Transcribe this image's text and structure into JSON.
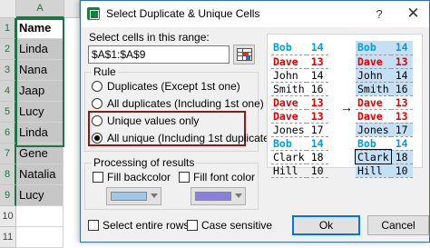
{
  "sheet": {
    "column": "A",
    "rows": [
      "1",
      "2",
      "3",
      "4",
      "5",
      "6",
      "7",
      "8",
      "9",
      "10",
      "11"
    ],
    "cells": [
      "Name",
      "Linda",
      "Nana",
      "Jaap",
      "Lucy",
      "Linda",
      "Gene",
      "Natalia",
      "Lucy",
      "",
      ""
    ]
  },
  "dialog": {
    "title": "Select Duplicate & Unique Cells",
    "help": "?",
    "close": "✕",
    "range_label": "Select cells in this range:",
    "range_value": "$A$1:$A$9",
    "rule": {
      "title": "Rule",
      "options": [
        {
          "label": "Duplicates (Except 1st one)",
          "selected": false
        },
        {
          "label": "All duplicates (Including 1st one)",
          "selected": false
        },
        {
          "label": "Unique values only",
          "selected": false
        },
        {
          "label": "All unique (Including 1st duplicates)",
          "selected": true
        }
      ]
    },
    "processing": {
      "title": "Processing of results",
      "fill_backcolor": "Fill backcolor",
      "fill_font_color": "Fill font color",
      "backcolor": "#9ec7e8",
      "font_color": "#8a7fe0"
    },
    "select_entire_rows": "Select entire rows",
    "case_sensitive": "Case sensitive",
    "ok": "Ok",
    "cancel": "Cancel"
  },
  "preview": {
    "arrow": "→",
    "before": [
      {
        "name": "Bob",
        "val": "14",
        "color": "#00a0d8",
        "bold": true,
        "bg": ""
      },
      {
        "name": "Dave",
        "val": "13",
        "color": "#e00000",
        "bold": true,
        "bg": ""
      },
      {
        "name": "John",
        "val": "14",
        "color": "#000000",
        "bold": false,
        "bg": ""
      },
      {
        "name": "Smith",
        "val": "16",
        "color": "#000000",
        "bold": false,
        "bg": ""
      },
      {
        "name": "Dave",
        "val": "13",
        "color": "#e00000",
        "bold": true,
        "bg": ""
      },
      {
        "name": "Dave",
        "val": "13",
        "color": "#e00000",
        "bold": true,
        "bg": ""
      },
      {
        "name": "Jones",
        "val": "17",
        "color": "#000000",
        "bold": false,
        "bg": ""
      },
      {
        "name": "Bob",
        "val": "14",
        "color": "#00a0d8",
        "bold": true,
        "bg": ""
      },
      {
        "name": "Clark",
        "val": "18",
        "color": "#000000",
        "bold": false,
        "bg": ""
      },
      {
        "name": "Hill",
        "val": "10",
        "color": "#000000",
        "bold": false,
        "bg": ""
      }
    ],
    "after": [
      {
        "name": "Bob",
        "val": "14",
        "color": "#00a0d8",
        "bold": true,
        "bg": "#c5dff5"
      },
      {
        "name": "Dave",
        "val": "13",
        "color": "#e00000",
        "bold": true,
        "bg": "#c5dff5"
      },
      {
        "name": "John",
        "val": "14",
        "color": "#000000",
        "bold": false,
        "bg": "#c5dff5"
      },
      {
        "name": "Smith",
        "val": "16",
        "color": "#000000",
        "bold": false,
        "bg": "#c5dff5"
      },
      {
        "name": "Dave",
        "val": "13",
        "color": "#e00000",
        "bold": true,
        "bg": ""
      },
      {
        "name": "Dave",
        "val": "13",
        "color": "#e00000",
        "bold": true,
        "bg": ""
      },
      {
        "name": "Jones",
        "val": "17",
        "color": "#000000",
        "bold": false,
        "bg": "#c5dff5"
      },
      {
        "name": "Bob",
        "val": "14",
        "color": "#00a0d8",
        "bold": true,
        "bg": ""
      },
      {
        "name": "Clark",
        "val": "18",
        "color": "#000000",
        "bold": false,
        "bg": "#c5dff5"
      },
      {
        "name": "Hill",
        "val": "10",
        "color": "#000000",
        "bold": false,
        "bg": "#c5dff5"
      }
    ]
  }
}
